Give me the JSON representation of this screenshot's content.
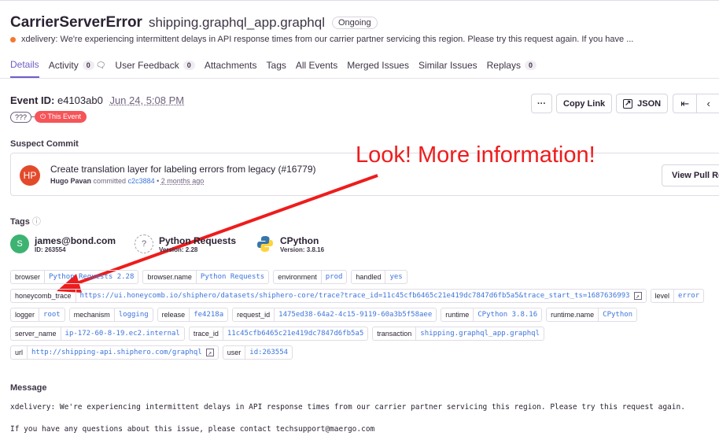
{
  "header": {
    "title": "CarrierServerError",
    "location": "shipping.graphql_app.graphql",
    "status": "Ongoing",
    "culprit": "xdelivery: We're experiencing intermittent delays in API response times from our carrier partner servicing this region. Please try this request again. If you have ..."
  },
  "tabs": [
    {
      "label": "Details",
      "active": true
    },
    {
      "label": "Activity",
      "count": "0"
    },
    {
      "label": "User Feedback",
      "count": "0"
    },
    {
      "label": "Attachments"
    },
    {
      "label": "Tags"
    },
    {
      "label": "All Events"
    },
    {
      "label": "Merged Issues"
    },
    {
      "label": "Similar Issues"
    },
    {
      "label": "Replays",
      "count": "0"
    }
  ],
  "event": {
    "id_label": "Event ID:",
    "id": "e4103ab0",
    "date": "Jun 24, 5:08 PM",
    "pill_unknown": "???",
    "pill_this": "This Event",
    "buttons": {
      "more": "···",
      "copy_link": "Copy Link",
      "json": "JSON",
      "first": "|<",
      "prev": "<"
    }
  },
  "suspect_commit": {
    "section_title": "Suspect Commit",
    "avatar": "HP",
    "message": "Create translation layer for labeling errors from legacy (#16779)",
    "author": "Hugo Pavan",
    "committed": "committed",
    "hash": "c2c3884",
    "ago": "2 months ago",
    "view_pr": "View Pull Re"
  },
  "annotation": {
    "text": "Look! More information!",
    "color": "#ee1c1c"
  },
  "tags": {
    "section_title": "Tags",
    "summary": [
      {
        "avatar": "S",
        "name": "james@bond.com",
        "sub": "ID: 263554"
      },
      {
        "avatar": "?",
        "name": "Python Requests",
        "sub": "Version: 2.28"
      },
      {
        "avatar": "python-logo-icon",
        "name": "CPython",
        "sub": "Version: 3.8.16"
      }
    ],
    "rows": [
      [
        {
          "k": "browser",
          "v": "Python Requests 2.28"
        },
        {
          "k": "browser.name",
          "v": "Python Requests"
        },
        {
          "k": "environment",
          "v": "prod"
        },
        {
          "k": "handled",
          "v": "yes"
        }
      ],
      [
        {
          "k": "honeycomb_trace",
          "v": "https://ui.honeycomb.io/shiphero/datasets/shiphero-core/trace?trace_id=11c45cfb6465c21e419dc7847d6fb5a5&trace_start_ts=1687636993",
          "link": true
        },
        {
          "k": "level",
          "v": "error"
        }
      ],
      [
        {
          "k": "logger",
          "v": "root"
        },
        {
          "k": "mechanism",
          "v": "logging"
        },
        {
          "k": "release",
          "v": "fe4218a"
        },
        {
          "k": "request_id",
          "v": "1475ed38-64a2-4c15-9119-60a3b5f58aee"
        },
        {
          "k": "runtime",
          "v": "CPython 3.8.16"
        },
        {
          "k": "runtime.name",
          "v": "CPython"
        }
      ],
      [
        {
          "k": "server_name",
          "v": "ip-172-60-8-19.ec2.internal"
        },
        {
          "k": "trace_id",
          "v": "11c45cfb6465c21e419dc7847d6fb5a5"
        },
        {
          "k": "transaction",
          "v": "shipping.graphql_app.graphql"
        }
      ],
      [
        {
          "k": "url",
          "v": "http://shipping-api.shiphero.com/graphql",
          "link": true
        },
        {
          "k": "user",
          "v": "id:263554"
        }
      ]
    ]
  },
  "message": {
    "section_title": "Message",
    "line1": "xdelivery: We're experiencing intermittent delays in API response times from our carrier partner servicing this region. Please try this request again.",
    "line2": "If you have any questions about this issue, please contact techsupport@maergo.com"
  }
}
